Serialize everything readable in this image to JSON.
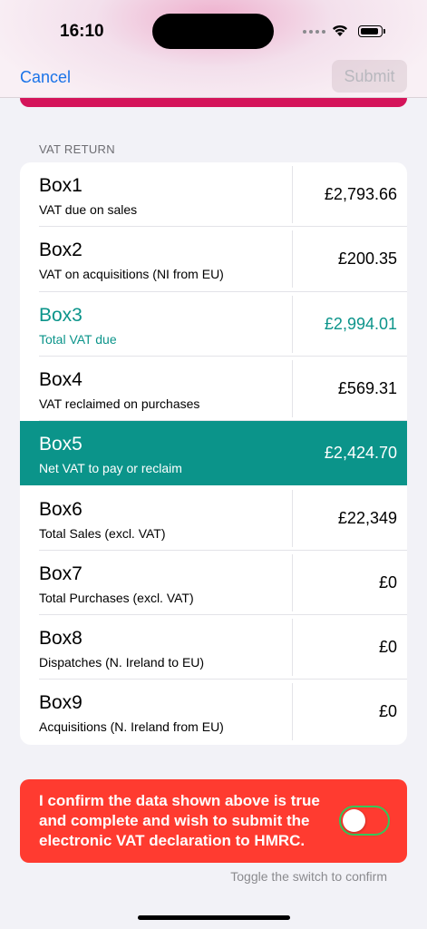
{
  "status_bar": {
    "time": "16:10"
  },
  "nav": {
    "cancel_label": "Cancel",
    "submit_label": "Submit"
  },
  "section": {
    "header": "VAT RETURN"
  },
  "boxes": [
    {
      "name": "Box1",
      "description": "VAT due on sales",
      "value": "£2,793.66"
    },
    {
      "name": "Box2",
      "description": "VAT on acquisitions (NI from EU)",
      "value": "£200.35"
    },
    {
      "name": "Box3",
      "description": "Total VAT due",
      "value": "£2,994.01"
    },
    {
      "name": "Box4",
      "description": "VAT reclaimed on purchases",
      "value": "£569.31"
    },
    {
      "name": "Box5",
      "description": "Net VAT to pay or reclaim",
      "value": "£2,424.70"
    },
    {
      "name": "Box6",
      "description": "Total Sales (excl. VAT)",
      "value": "£22,349"
    },
    {
      "name": "Box7",
      "description": "Total Purchases (excl. VAT)",
      "value": "£0"
    },
    {
      "name": "Box8",
      "description": "Dispatches (N. Ireland to EU)",
      "value": "£0"
    },
    {
      "name": "Box9",
      "description": "Acquisitions (N. Ireland from EU)",
      "value": "£0"
    }
  ],
  "confirm": {
    "text": "I confirm the data shown above is true and complete and wish to submit the electronic VAT declaration to HMRC.",
    "toggle_on": false,
    "hint": "Toggle the switch to confirm"
  },
  "colors": {
    "accent": "#1a73e8",
    "teal": "#0b948a",
    "alert_red": "#ff3b30",
    "strip": "#d4145a"
  }
}
